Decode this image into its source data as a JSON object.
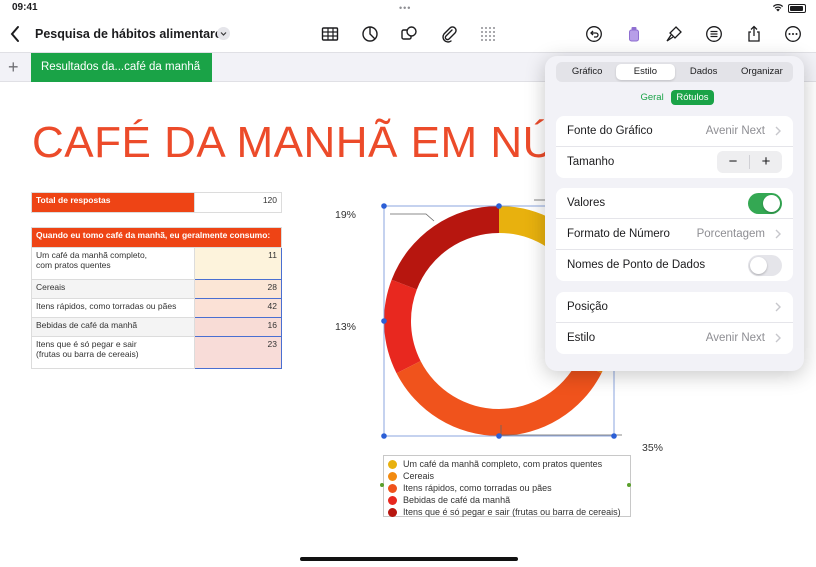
{
  "status": {
    "time": "09:41",
    "dots": "•••"
  },
  "toolbar": {
    "title": "Pesquisa de hábitos alimentares"
  },
  "sheets": {
    "active": "Resultados da...café da manhã",
    "add": "+"
  },
  "canvas": {
    "title": "CAFÉ DA MANHÃ EM NÚ"
  },
  "total_table": {
    "label": "Total de respostas",
    "value": "120"
  },
  "data_table": {
    "header": "Quando eu tomo café da manhã, eu geralmente consumo:",
    "rows": [
      {
        "label_line1": "Um café da manhã completo,",
        "label_line2": "com pratos quentes",
        "value": "11"
      },
      {
        "label_line1": "Cereais",
        "label_line2": "",
        "value": "28"
      },
      {
        "label_line1": "Itens rápidos, como torradas ou pães",
        "label_line2": "",
        "value": "42"
      },
      {
        "label_line1": "Bebidas de café da manhã",
        "label_line2": "",
        "value": "16"
      },
      {
        "label_line1": "Itens que é só pegar e sair",
        "label_line2": "(frutas ou barra de cereais)",
        "value": "23"
      }
    ]
  },
  "chart_data": {
    "type": "pie",
    "categories": [
      "Um café da manhã completo, com pratos quentes",
      "Cereais",
      "Itens rápidos, como torradas ou pães",
      "Bebidas de café da manhã",
      "Itens que é só pegar e sair (frutas ou barra de cereais)"
    ],
    "values": [
      11,
      28,
      42,
      16,
      23
    ],
    "visible_labels": [
      "19%",
      "13%",
      "35%"
    ],
    "colors": [
      "#e8b10e",
      "#f28a10",
      "#f0531c",
      "#e8281f",
      "#b7160f"
    ],
    "legend": "bottom",
    "donut": true
  },
  "popover": {
    "tabs": [
      "Gráfico",
      "Estilo",
      "Dados",
      "Organizar"
    ],
    "active_tab": "Estilo",
    "subtabs": [
      "Geral",
      "Rótulos"
    ],
    "active_subtab": "Rótulos",
    "font_label": "Fonte do Gráfico",
    "font_value": "Avenir Next",
    "size_label": "Tamanho",
    "minus": "−",
    "plus": "+",
    "values_label": "Valores",
    "values_on": true,
    "number_format_label": "Formato de Número",
    "number_format_value": "Porcentagem",
    "point_names_label": "Nomes de Ponto de Dados",
    "point_names_on": false,
    "position_label": "Posição",
    "style_label": "Estilo",
    "style_value": "Avenir Next"
  },
  "colors": {
    "accent": "#1aa347",
    "title": "#ec4b2a",
    "table_header": "#ee4415"
  }
}
